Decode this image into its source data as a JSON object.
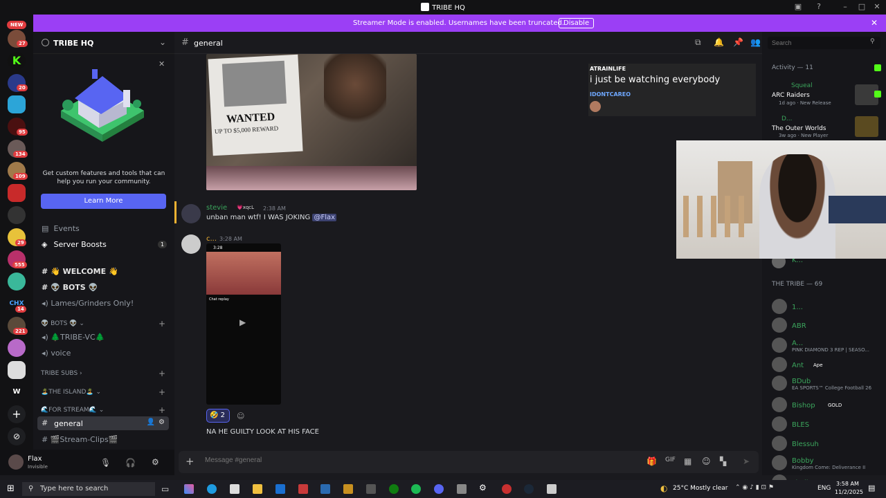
{
  "window": {
    "title": "TRIBE HQ"
  },
  "banner": {
    "text": "Streamer Mode is enabled. Usernames have been truncated.",
    "button": "Disable"
  },
  "servers": {
    "new_label": "NEW",
    "badges": [
      "27",
      "20",
      "95",
      "134",
      "109",
      "29",
      "555",
      "14",
      "221"
    ],
    "chx_label": "CHX",
    "w_label": "W"
  },
  "sidebar": {
    "server_name": "TRIBE HQ",
    "promo_text": "Get custom features and tools that can help you run your community.",
    "learn_more": "Learn More",
    "events": "Events",
    "boosts": "Server Boosts",
    "boosts_count": "1",
    "channels": [
      {
        "name": "👋 WELCOME 👋"
      },
      {
        "name": "👽 BOTS 👽"
      },
      {
        "name": "Lames/Grinders Only!"
      }
    ],
    "cat_bots": "👽 BOTS 👽",
    "voice_tribe": "🌲TRIBE-VC🌲",
    "voice": "voice",
    "cat_subs": "TRIBE SUBS",
    "cat_island": "🏝️THE ISLAND🏝️",
    "cat_stream": "🌊FOR STREAM🌊",
    "ch_general": "general",
    "ch_clips": "🎬Stream-Clips🎬"
  },
  "user": {
    "name": "Flax",
    "status": "Invisible"
  },
  "chat": {
    "channel": "general",
    "wanted_text": "WANTED",
    "reward_text": "UP TO $5,000 REWARD",
    "msg1": {
      "name": "stevie",
      "tag": "xqcL",
      "time": "2:38 AM",
      "text": "unban man wtf! I WAS JOKING",
      "mention": "@Flax"
    },
    "msg2": {
      "name": "c...",
      "time": "3:28 AM",
      "phone_time": "3:28",
      "chat_replay": "Chat replay"
    },
    "reaction": {
      "emoji": "🤣",
      "count": "2"
    },
    "msg3": {
      "text": "NA HE GUILTY LOOK AT HIS FACE"
    },
    "input_placeholder": "Message #general"
  },
  "overlay": {
    "user1": "ATRAINLIFE",
    "text": "i just be watching everybody",
    "user2": "IDONTCAREO"
  },
  "members": {
    "search_placeholder": "Search",
    "activity_header": "Activity — 11",
    "act1_user": "Squeal",
    "act1_game": "ARC Raiders",
    "act1_meta": "1d ago · New Release",
    "act2_user": "D...",
    "act2_game": "The Outer Worlds",
    "act2_meta": "3w ago · New Player",
    "k_member": "K...",
    "tribe_header": "THE TRIBE — 69",
    "list": [
      {
        "name": "1...",
        "status": "",
        "tag": ""
      },
      {
        "name": "ABR",
        "status": "",
        "tag": ""
      },
      {
        "name": "A...",
        "status": "PINK DIAMOND 3 REP | SEASO...",
        "tag": ""
      },
      {
        "name": "Ant",
        "status": "",
        "tag": "Ape"
      },
      {
        "name": "BDub",
        "status": "EA SPORTS™ College Football 26",
        "tag": ""
      },
      {
        "name": "Bishop",
        "status": "",
        "tag": "GOLD"
      },
      {
        "name": "BLES",
        "status": "",
        "tag": ""
      },
      {
        "name": "Blessuh",
        "status": "",
        "tag": ""
      },
      {
        "name": "Bobby",
        "status": "Kingdom Come: Deliverance II",
        "tag": ""
      },
      {
        "name": "cbells",
        "status": "",
        "tag": ""
      }
    ]
  },
  "taskbar": {
    "search": "Type here to search",
    "weather": "25°C  Mostly clear",
    "lang": "ENG",
    "time": "3:58 AM",
    "date": "11/2/2025"
  },
  "colors": {
    "accent": "#5865f2",
    "banner": "#9b3ff5",
    "online": "#3ba55c"
  }
}
